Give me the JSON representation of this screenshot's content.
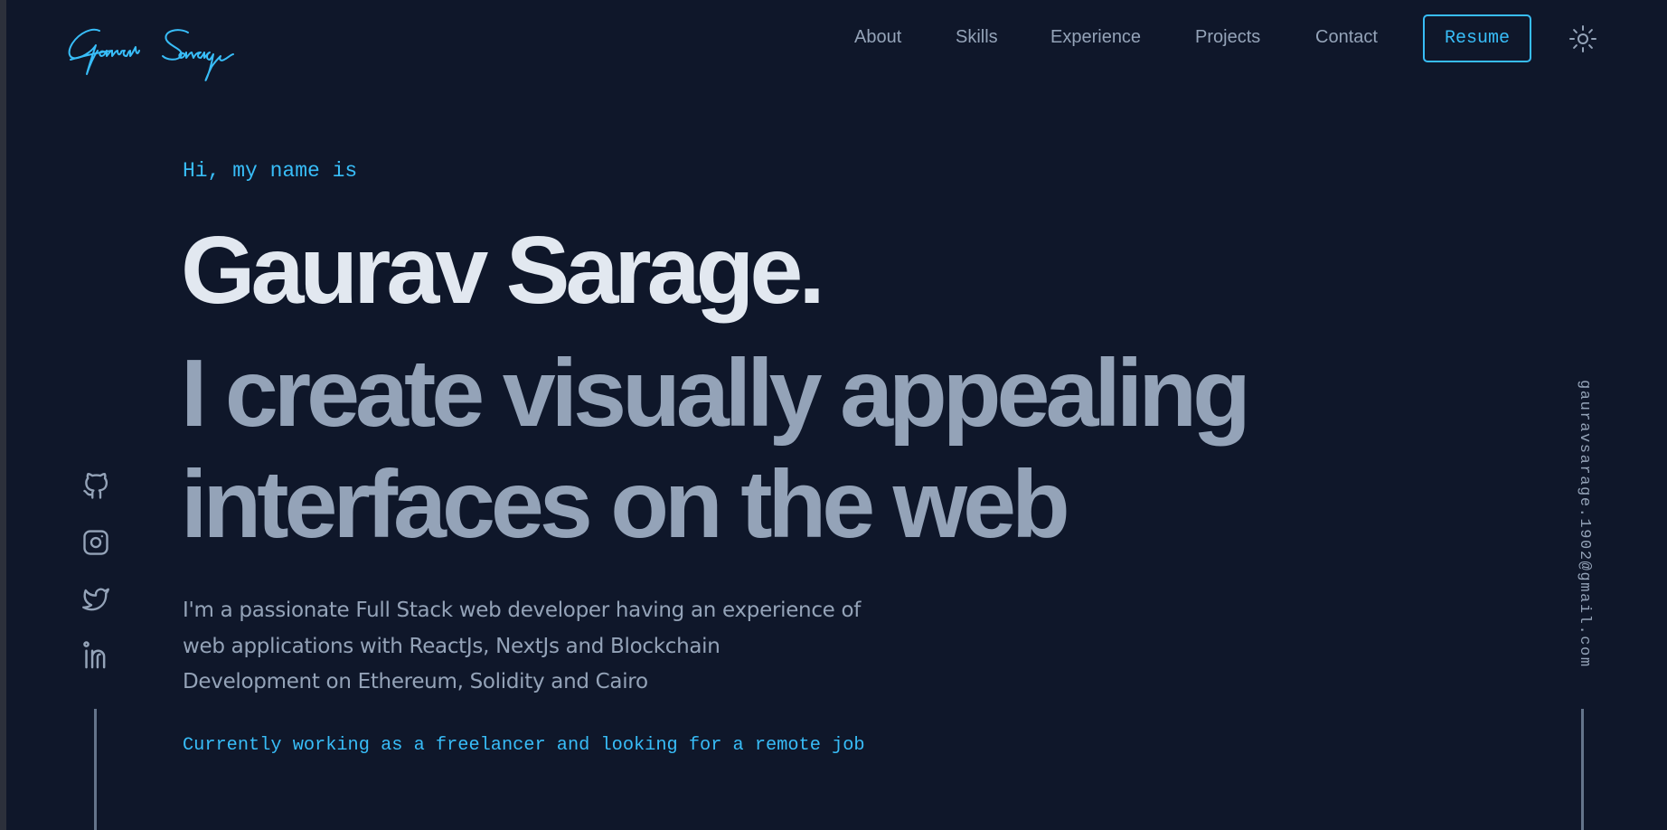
{
  "colors": {
    "background": "#0f172a",
    "accent": "#38bdf8",
    "heading": "#e2e8f0",
    "muted": "#94a3b8",
    "line": "#64748b"
  },
  "header": {
    "logo_text": "Gaurav Sarage",
    "nav": [
      {
        "label": "About"
      },
      {
        "label": "Skills"
      },
      {
        "label": "Experience"
      },
      {
        "label": "Projects"
      },
      {
        "label": "Contact"
      }
    ],
    "resume_label": "Resume",
    "theme_toggle_icon": "sun-icon"
  },
  "hero": {
    "intro": "Hi, my name is",
    "name": "Gaurav Sarage.",
    "tagline_lines": [
      "I create visually appealing",
      "interfaces on the web"
    ],
    "description_lines": [
      "I'm a passionate Full Stack web developer having an experience of",
      "web applications with ReactJs, NextJs and Blockchain",
      "Development on Ethereum, Solidity and Cairo"
    ],
    "status": "Currently working as a freelancer and looking for a remote job"
  },
  "socials": [
    {
      "name": "GitHub",
      "icon": "github-icon"
    },
    {
      "name": "Instagram",
      "icon": "instagram-icon"
    },
    {
      "name": "Twitter",
      "icon": "twitter-icon"
    },
    {
      "name": "LinkedIn",
      "icon": "linkedin-icon"
    }
  ],
  "email": "gauravsarage.1902@gmail.com"
}
